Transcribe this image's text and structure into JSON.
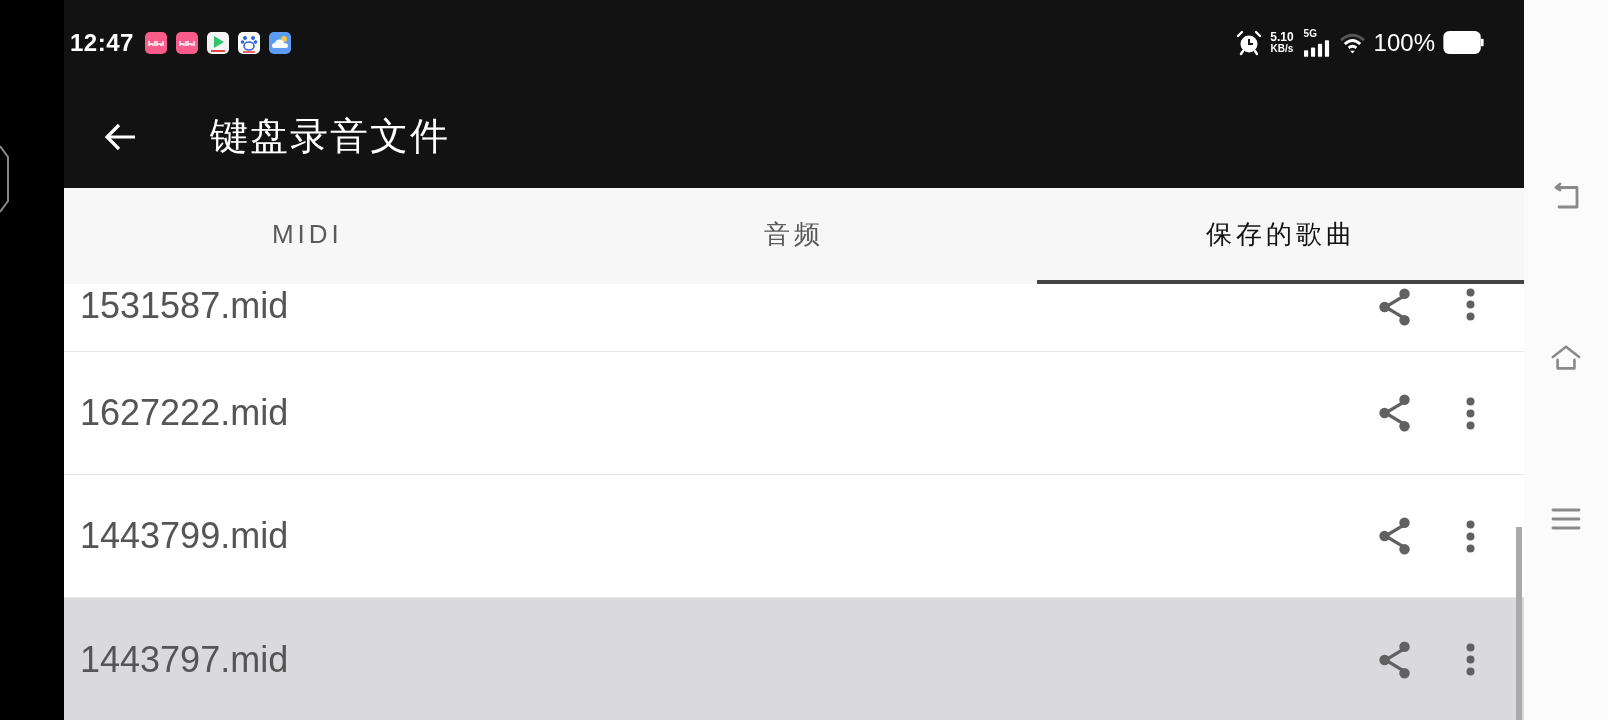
{
  "status_bar": {
    "time": "12:47",
    "network_speed": "5.10",
    "speed_unit": "KB/s",
    "network_type": "5G",
    "battery_percent": "100%"
  },
  "toolbar": {
    "title": "键盘录音文件"
  },
  "tabs": [
    {
      "label": "MIDI",
      "selected": false
    },
    {
      "label": "音频",
      "selected": false
    },
    {
      "label": "保存的歌曲",
      "selected": true
    }
  ],
  "files": [
    {
      "name": "1531587.mid",
      "selected": false
    },
    {
      "name": "1627222.mid",
      "selected": false
    },
    {
      "name": "1443799.mid",
      "selected": false
    },
    {
      "name": "1443797.mid",
      "selected": true
    }
  ]
}
